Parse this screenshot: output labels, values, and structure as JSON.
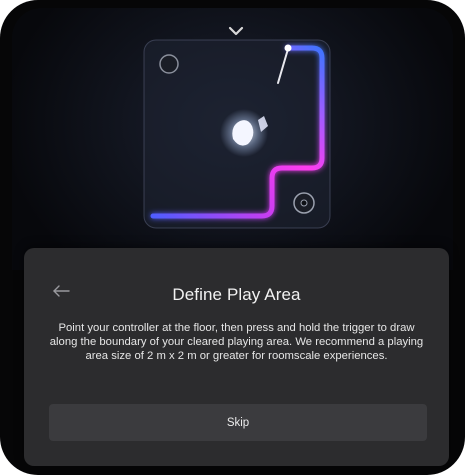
{
  "dialog": {
    "title": "Define Play Area",
    "description": "Point your controller at the floor, then press and hold the trigger to draw along the boundary of your cleared playing area. We recommend a playing area size of 2 m x 2 m or greater for roomscale experiences.",
    "skip_label": "Skip"
  },
  "icons": {
    "collapse": "chevron-down-icon",
    "back": "back-arrow-icon"
  },
  "colors": {
    "boundary_start": "#7b5cff",
    "boundary_mid": "#ff3cf0",
    "boundary_end": "#3d74ff",
    "panel": "#2c2c2e"
  }
}
